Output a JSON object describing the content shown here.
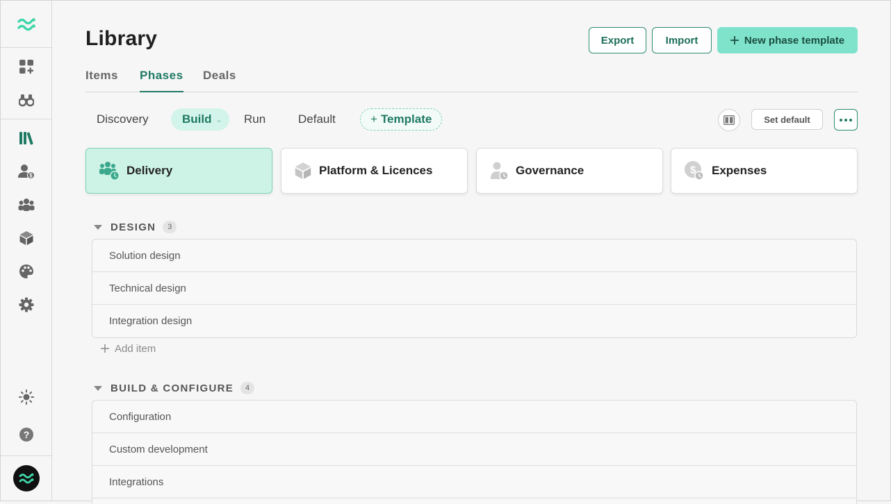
{
  "colors": {
    "accent": "#1f7a63",
    "accent_light": "#7fe3cc",
    "active_card_bg": "#cdf3e6",
    "logo_teal": "#3ed6a8"
  },
  "sidebar": {
    "items": [
      {
        "icon": "dashboard-add-icon"
      },
      {
        "icon": "binoculars-icon"
      },
      {
        "icon": "library-books-icon",
        "active": true
      },
      {
        "icon": "user-dollar-icon"
      },
      {
        "icon": "team-icon"
      },
      {
        "icon": "box-icon"
      },
      {
        "icon": "palette-icon"
      },
      {
        "icon": "gear-icon"
      }
    ],
    "bottom": [
      {
        "icon": "sun-icon"
      },
      {
        "icon": "help-icon"
      }
    ]
  },
  "header": {
    "title": "Library",
    "export_label": "Export",
    "import_label": "Import",
    "new_label": "New phase template"
  },
  "tabs": [
    {
      "label": "Items"
    },
    {
      "label": "Phases",
      "active": true
    },
    {
      "label": "Deals"
    }
  ],
  "phase_tabs": {
    "discovery": "Discovery",
    "build": "Build",
    "run": "Run",
    "default": "Default",
    "template": "Template",
    "set_default": "Set default"
  },
  "cards": [
    {
      "label": "Delivery",
      "icon": "team-clock-icon",
      "active": true
    },
    {
      "label": "Platform & Licences",
      "icon": "box-icon"
    },
    {
      "label": "Governance",
      "icon": "user-clock-icon"
    },
    {
      "label": "Expenses",
      "icon": "dollar-clock-icon"
    }
  ],
  "sections": [
    {
      "title": "DESIGN",
      "count": "3",
      "items": [
        "Solution design",
        "Technical design",
        "Integration design"
      ]
    },
    {
      "title": "BUILD & CONFIGURE",
      "count": "4",
      "items": [
        "Configuration",
        "Custom development",
        "Integrations"
      ]
    }
  ],
  "add_item_label": "Add item"
}
